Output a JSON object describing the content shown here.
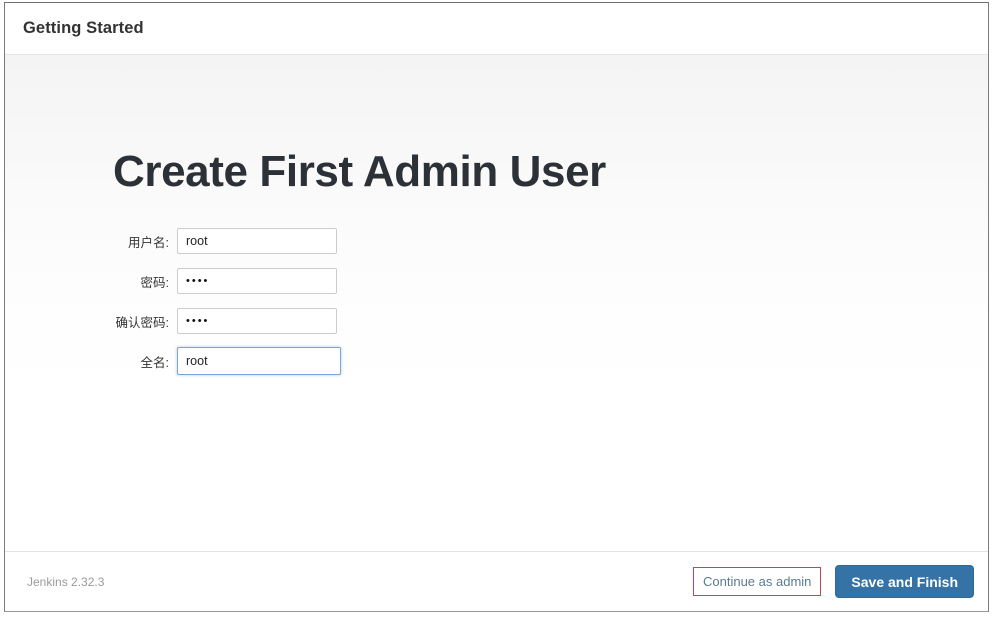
{
  "window": {
    "header": {
      "title": "Getting Started"
    }
  },
  "main": {
    "page_title": "Create First Admin User",
    "form": {
      "fields": [
        {
          "label": "用户名:",
          "value": "root",
          "type": "text",
          "focused": false
        },
        {
          "label": "密码:",
          "value": "••••",
          "type": "password",
          "focused": false
        },
        {
          "label": "确认密码:",
          "value": "••••",
          "type": "password",
          "focused": false
        },
        {
          "label": "全名:",
          "value": "root",
          "type": "text",
          "focused": true
        }
      ]
    }
  },
  "footer": {
    "version": "Jenkins 2.32.3",
    "continue_label": "Continue as admin",
    "save_label": "Save and Finish"
  },
  "colors": {
    "accent_blue": "#3573a6",
    "highlight_red": "#c7405e",
    "title_text": "#2c3138",
    "link_text": "#5a7a92",
    "version_text": "#9a9a9a",
    "focus_border": "#7aa7d4"
  }
}
